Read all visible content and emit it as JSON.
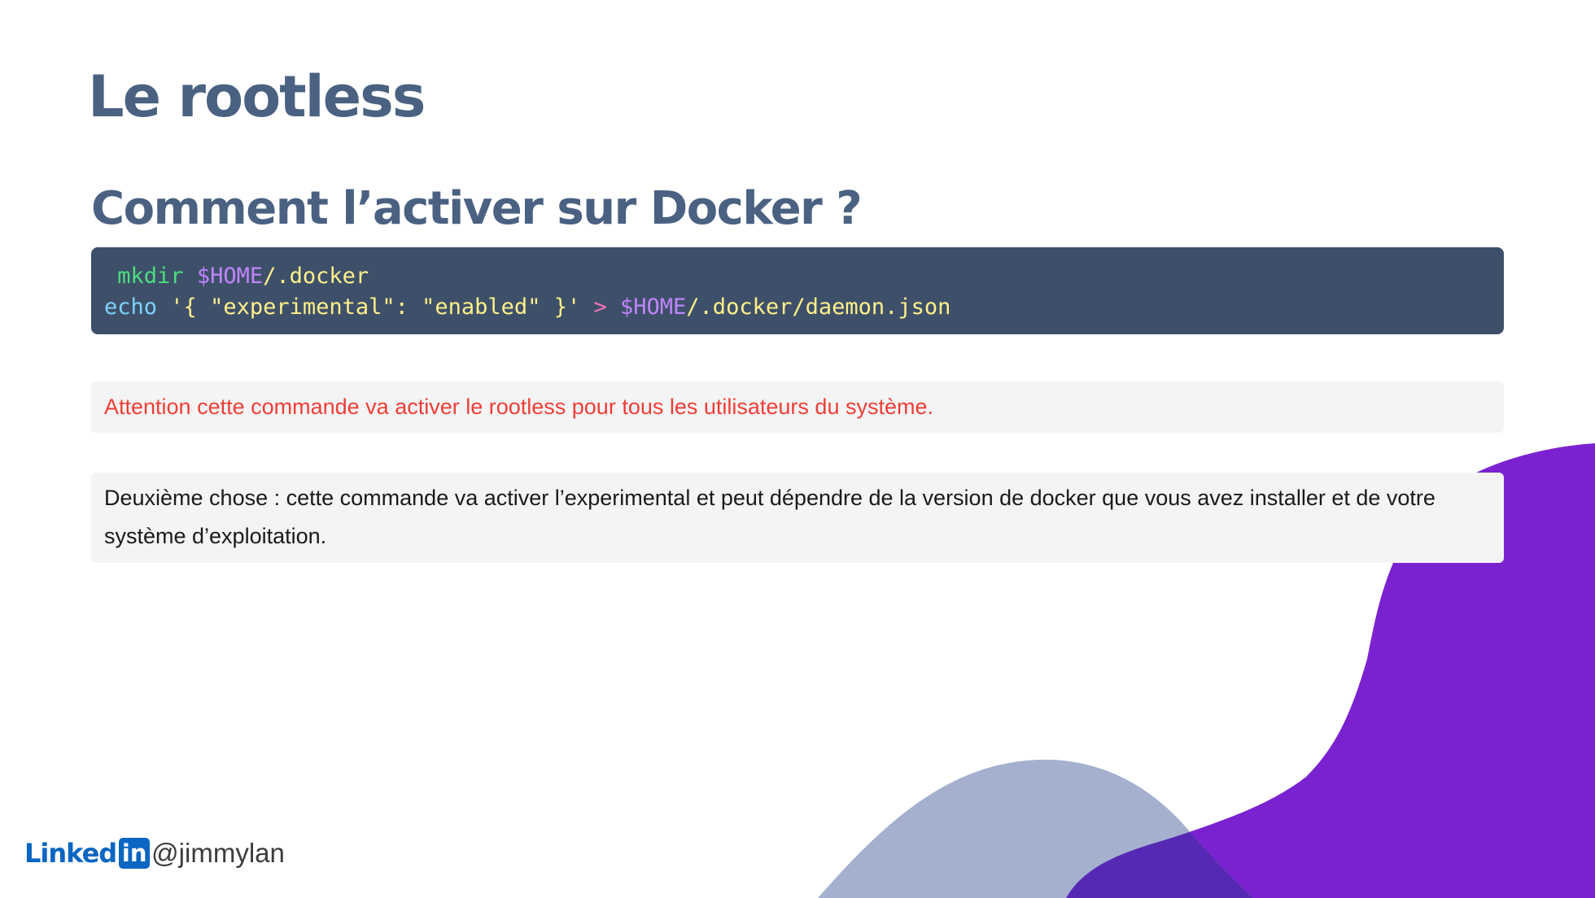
{
  "slide": {
    "title": "Le rootless",
    "section_title": "Comment l’activer sur Docker ?"
  },
  "code": {
    "line1": {
      "cmd": "mkdir",
      "var": "$HOME",
      "path": "/.docker"
    },
    "line2": {
      "cmd": "echo",
      "string": "'{ \"experimental\": \"enabled\" }'",
      "op": ">",
      "var": "$HOME",
      "path": "/.docker/daemon.json"
    }
  },
  "notes": {
    "warning": "Attention cette commande va activer le rootless pour tous les utilisateurs du système.",
    "info": "Deuxième chose : cette commande va activer l’experimental et peut dépendre de la version de docker que vous avez installer et de votre système d’exploitation."
  },
  "footer": {
    "brand_word": "Linked",
    "brand_badge": "in",
    "handle": "@jimmylan"
  },
  "colors": {
    "title": "#4a6182",
    "code_bg": "#3e5069",
    "warning_text": "#ef3e36",
    "note_bg": "#f4f4f4",
    "blob_purple": "#7b22d0",
    "blob_slate": "#a5b0cf",
    "blob_overlap": "#5529b3",
    "linkedin_blue": "#0a66c2"
  },
  "icons": {
    "brand": "linkedin-logo-icon"
  }
}
